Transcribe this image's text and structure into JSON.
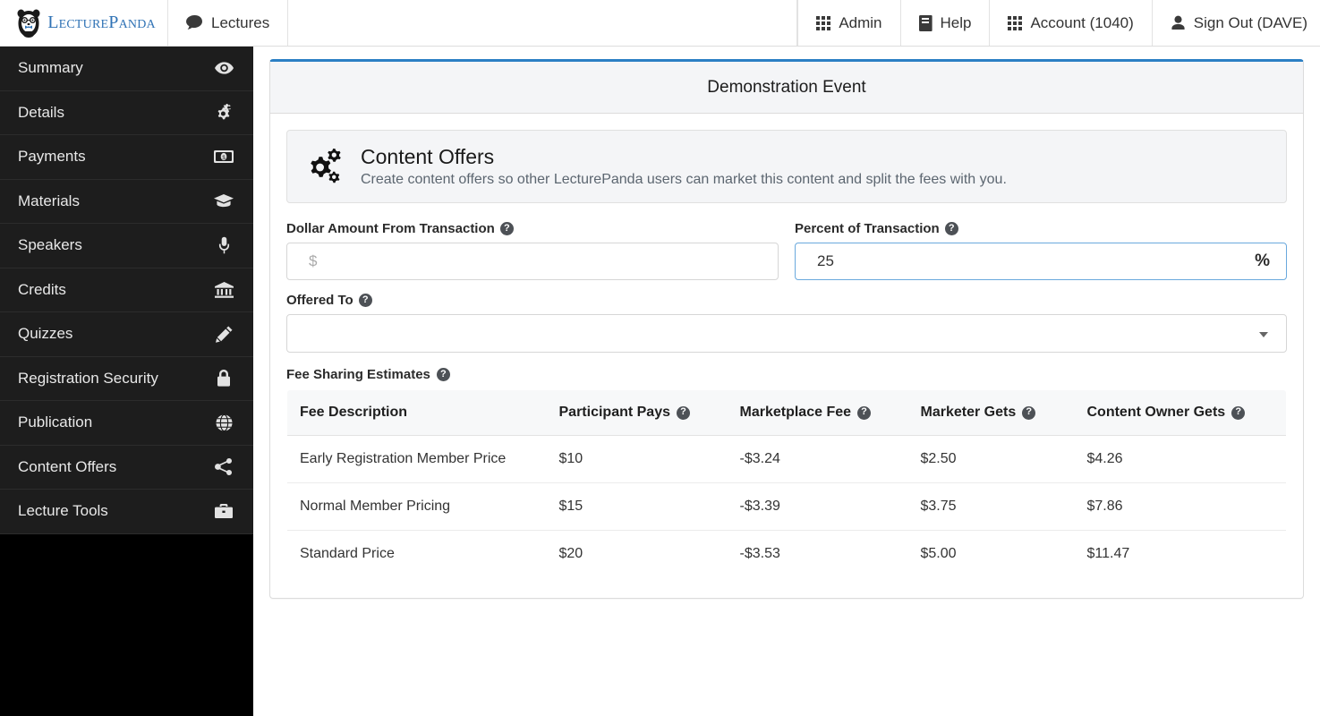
{
  "topnav": {
    "brand": {
      "text": "LecturePanda",
      "icon": "panda-logo"
    },
    "left_items": [
      {
        "label": "Lectures",
        "icon": "comment-icon"
      }
    ],
    "right_items": [
      {
        "label": "Admin",
        "icon": "grid-icon"
      },
      {
        "label": "Help",
        "icon": "book-icon"
      },
      {
        "label": "Account (1040)",
        "icon": "grid-icon"
      },
      {
        "label": "Sign Out (DAVE)",
        "icon": "user-icon"
      }
    ]
  },
  "sidebar": {
    "items": [
      {
        "label": "Summary",
        "icon": "eye-icon"
      },
      {
        "label": "Details",
        "icon": "gears-icon"
      },
      {
        "label": "Payments",
        "icon": "money-bill-icon"
      },
      {
        "label": "Materials",
        "icon": "graduation-cap-icon"
      },
      {
        "label": "Speakers",
        "icon": "microphone-icon"
      },
      {
        "label": "Credits",
        "icon": "bank-icon"
      },
      {
        "label": "Quizzes",
        "icon": "pencil-icon"
      },
      {
        "label": "Registration Security",
        "icon": "lock-icon"
      },
      {
        "label": "Publication",
        "icon": "globe-icon"
      },
      {
        "label": "Content Offers",
        "icon": "share-icon"
      },
      {
        "label": "Lecture Tools",
        "icon": "briefcase-icon"
      }
    ]
  },
  "panel": {
    "title": "Demonstration Event",
    "accent_color": "#2b7fc4"
  },
  "banner": {
    "icon": "gears-icon",
    "title": "Content Offers",
    "subtitle": "Create content offers so other LecturePanda users can market this content and split the fees with you."
  },
  "form": {
    "dollar_amount": {
      "label": "Dollar Amount From Transaction",
      "help": "?",
      "value": "",
      "placeholder": "$"
    },
    "percent": {
      "label": "Percent of Transaction",
      "help": "?",
      "value": "25",
      "placeholder": "",
      "suffix": "%"
    },
    "offered_to": {
      "label": "Offered To",
      "help": "?",
      "value": "",
      "caret": "chevron-down-icon"
    }
  },
  "fees": {
    "section_label": "Fee Sharing Estimates",
    "help": "?",
    "columns": [
      {
        "label": "Fee Description",
        "help": false
      },
      {
        "label": "Participant Pays",
        "help": true
      },
      {
        "label": "Marketplace Fee",
        "help": true
      },
      {
        "label": "Marketer Gets",
        "help": true
      },
      {
        "label": "Content Owner Gets",
        "help": true
      }
    ],
    "help_glyph": "?",
    "rows": [
      {
        "description": "Early Registration Member Price",
        "participant_pays": "$10",
        "marketplace_fee": "-$3.24",
        "marketer_gets": "$2.50",
        "content_owner_gets": "$4.26"
      },
      {
        "description": "Normal Member Pricing",
        "participant_pays": "$15",
        "marketplace_fee": "-$3.39",
        "marketer_gets": "$3.75",
        "content_owner_gets": "$7.86"
      },
      {
        "description": "Standard Price",
        "participant_pays": "$20",
        "marketplace_fee": "-$3.53",
        "marketer_gets": "$5.00",
        "content_owner_gets": "$11.47"
      }
    ]
  }
}
